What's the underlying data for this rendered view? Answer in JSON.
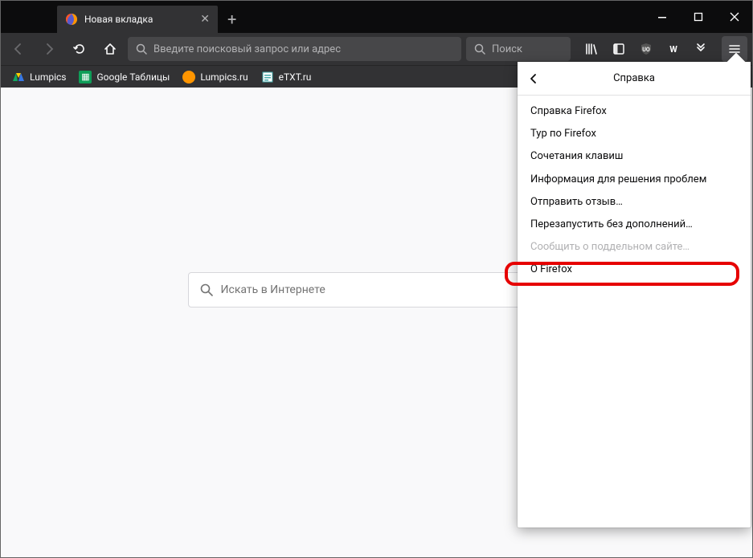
{
  "tab": {
    "title": "Новая вкладка"
  },
  "urlbar": {
    "placeholder": "Введите поисковый запрос или адрес"
  },
  "searchbar": {
    "placeholder": "Поиск"
  },
  "bookmarks": [
    {
      "label": "Lumpics",
      "icon": "drive",
      "color": "#000"
    },
    {
      "label": "Google Таблицы",
      "icon": "sheets",
      "color": "#0f9d58"
    },
    {
      "label": "Lumpics.ru",
      "icon": "orange",
      "color": "#ff9500"
    },
    {
      "label": "eTXT.ru",
      "icon": "etxt",
      "color": "#fff"
    }
  ],
  "content_search": {
    "placeholder": "Искать в Интернете"
  },
  "help": {
    "title": "Справка",
    "items": [
      {
        "label": "Справка Firefox",
        "disabled": false
      },
      {
        "label": "Тур по Firefox",
        "disabled": false
      },
      {
        "label": "Сочетания клавиш",
        "disabled": false
      },
      {
        "label": "Информация для решения проблем",
        "disabled": false
      },
      {
        "label": "Отправить отзыв…",
        "disabled": false
      },
      {
        "label": "Перезапустить без дополнений…",
        "disabled": false
      },
      {
        "label": "Сообщить о поддельном сайте…",
        "disabled": true
      },
      {
        "label": "О Firefox",
        "disabled": false,
        "highlighted": true
      }
    ]
  }
}
